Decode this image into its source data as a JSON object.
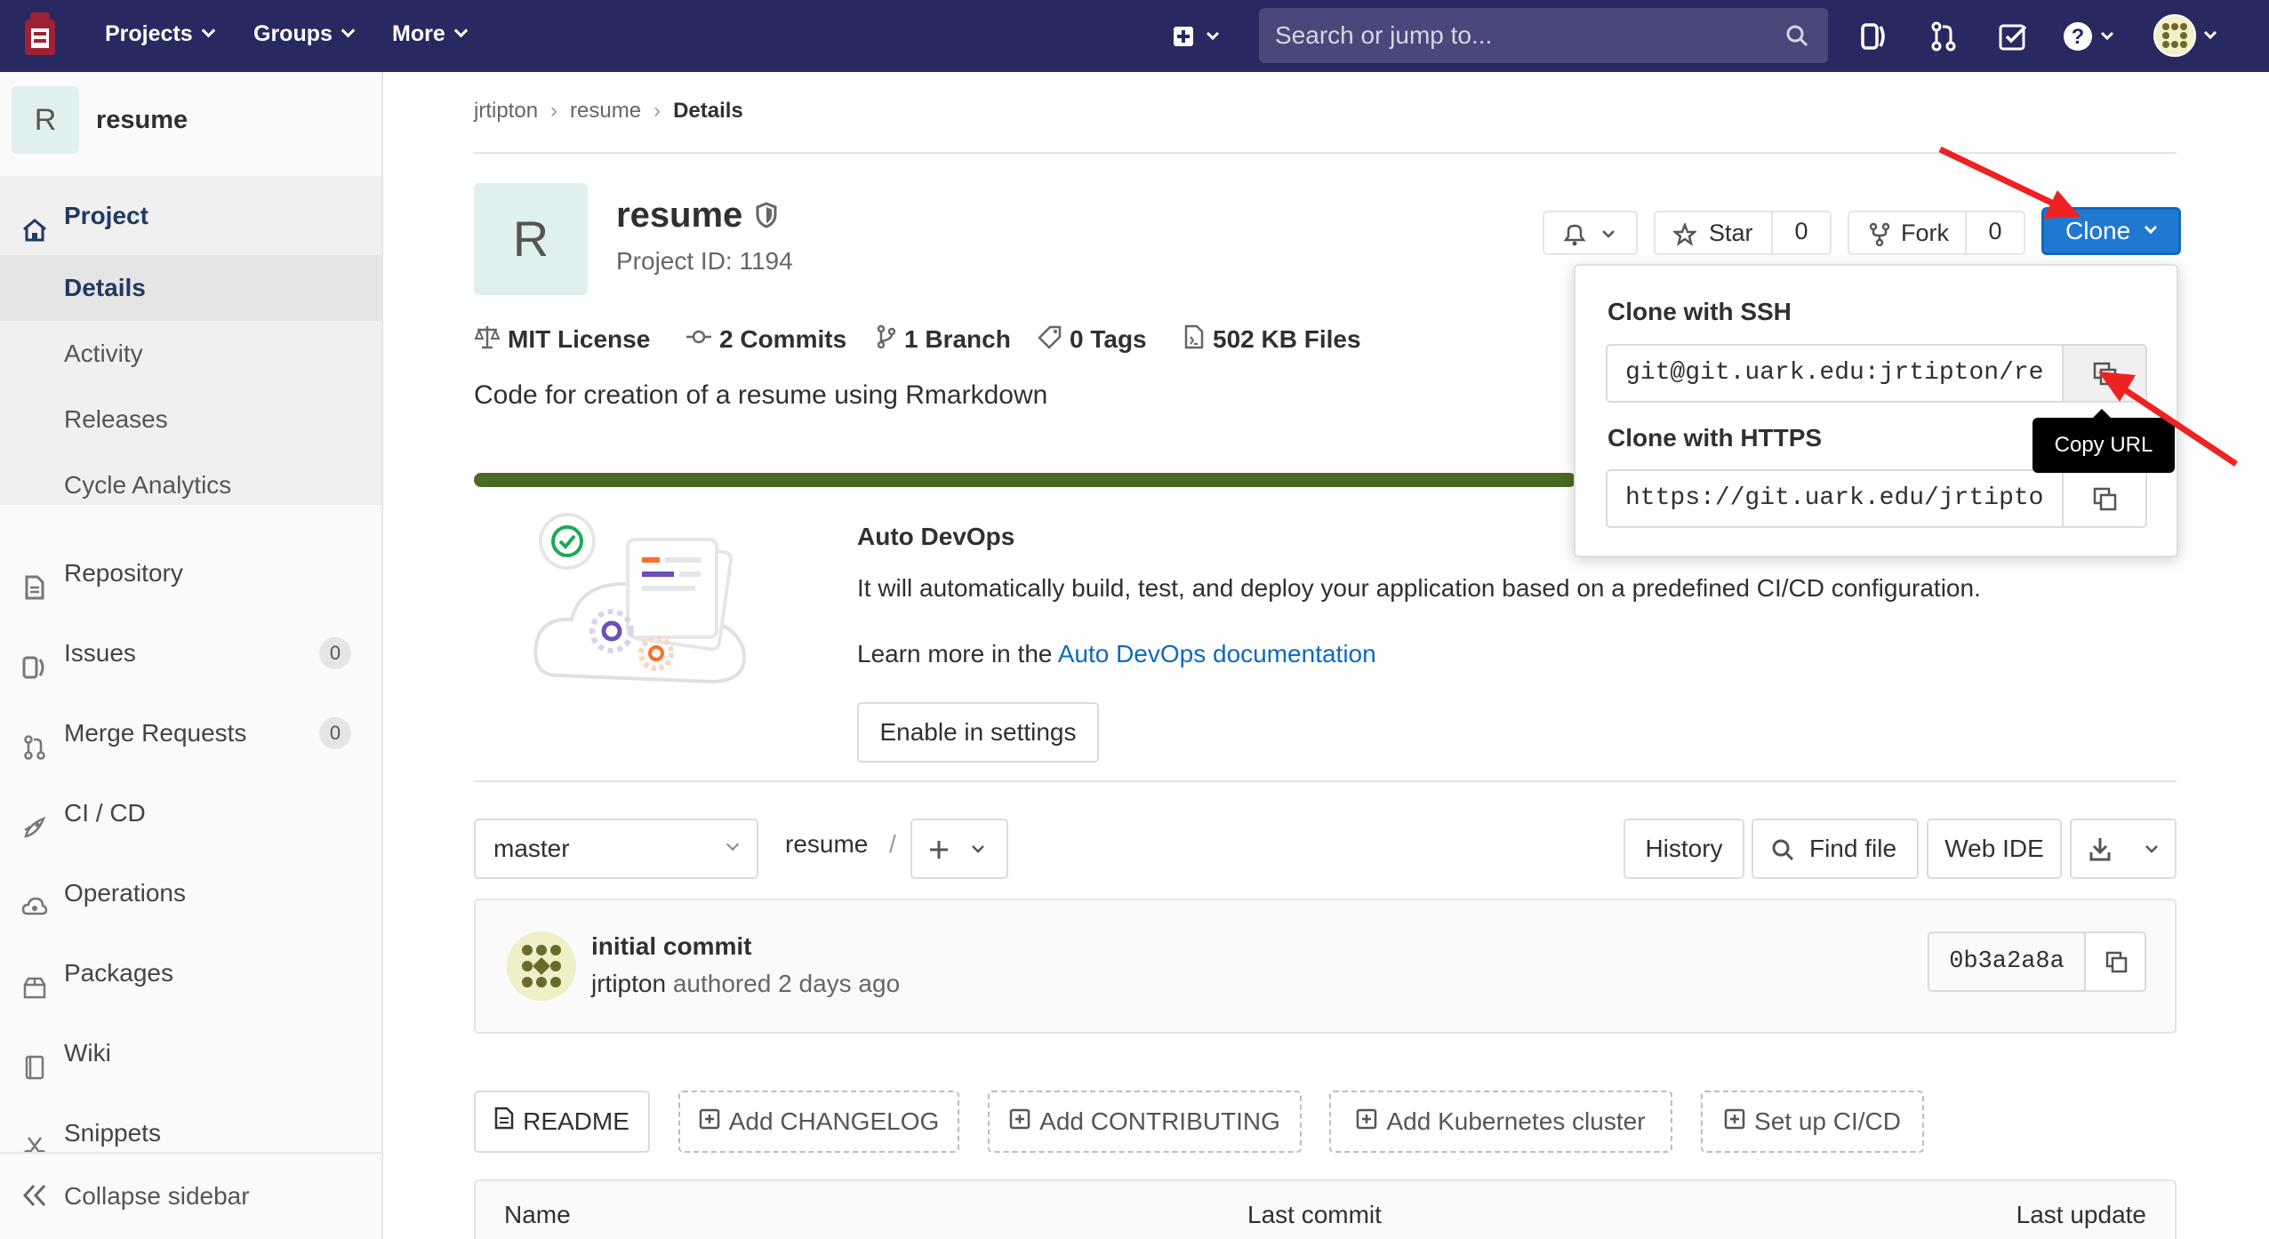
{
  "navbar": {
    "projects_label": "Projects",
    "groups_label": "Groups",
    "more_label": "More",
    "search_placeholder": "Search or jump to...",
    "bg_color": "#292961"
  },
  "sidebar": {
    "project_avatar_letter": "R",
    "project_name": "resume",
    "project_label": "Project",
    "project_subitems": [
      "Details",
      "Activity",
      "Releases",
      "Cycle Analytics"
    ],
    "repository_label": "Repository",
    "issues_label": "Issues",
    "issues_count": "0",
    "merge_requests_label": "Merge Requests",
    "merge_requests_count": "0",
    "cicd_label": "CI / CD",
    "operations_label": "Operations",
    "packages_label": "Packages",
    "wiki_label": "Wiki",
    "snippets_label": "Snippets",
    "collapse_label": "Collapse sidebar"
  },
  "breadcrumb": [
    "jrtipton",
    "resume",
    "Details"
  ],
  "project": {
    "avatar_letter": "R",
    "title": "resume",
    "project_id": "Project ID: 1194",
    "star_label": "Star",
    "star_count": "0",
    "fork_label": "Fork",
    "fork_count": "0",
    "clone_label": "Clone",
    "license": "MIT License",
    "commits": "2 Commits",
    "branches": "1 Branch",
    "tags": "0 Tags",
    "files": "502 KB Files",
    "description": "Code for creation of a resume using Rmarkdown"
  },
  "clone_dropdown": {
    "ssh_heading": "Clone with SSH",
    "ssh_url": "git@git.uark.edu:jrtipton/re",
    "https_heading": "Clone with HTTPS",
    "https_url": "https://git.uark.edu/jrtipto",
    "tooltip": "Copy URL"
  },
  "auto_devops": {
    "title": "Auto DevOps",
    "text": "It will automatically build, test, and deploy your application based on a predefined CI/CD configuration.",
    "learn_prefix": "Learn more in the ",
    "learn_link": "Auto DevOps documentation",
    "enable_button": "Enable in settings"
  },
  "repo_toolbar": {
    "branch": "master",
    "path_root": "resume",
    "path_sep": "/",
    "history": "History",
    "find_file": "Find file",
    "web_ide": "Web IDE"
  },
  "last_commit": {
    "title": "initial commit",
    "author": "jrtipton",
    "meta": "authored 2 days ago",
    "sha": "0b3a2a8a"
  },
  "quick_actions": [
    "README",
    "Add CHANGELOG",
    "Add CONTRIBUTING",
    "Add Kubernetes cluster",
    "Set up CI/CD"
  ],
  "file_table": {
    "col_name": "Name",
    "col_last_commit": "Last commit",
    "col_last_update": "Last update"
  },
  "colors": {
    "accent_blue": "#1f78d1",
    "progress_green": "#4a6a23",
    "annotation_red": "#ee2222"
  }
}
